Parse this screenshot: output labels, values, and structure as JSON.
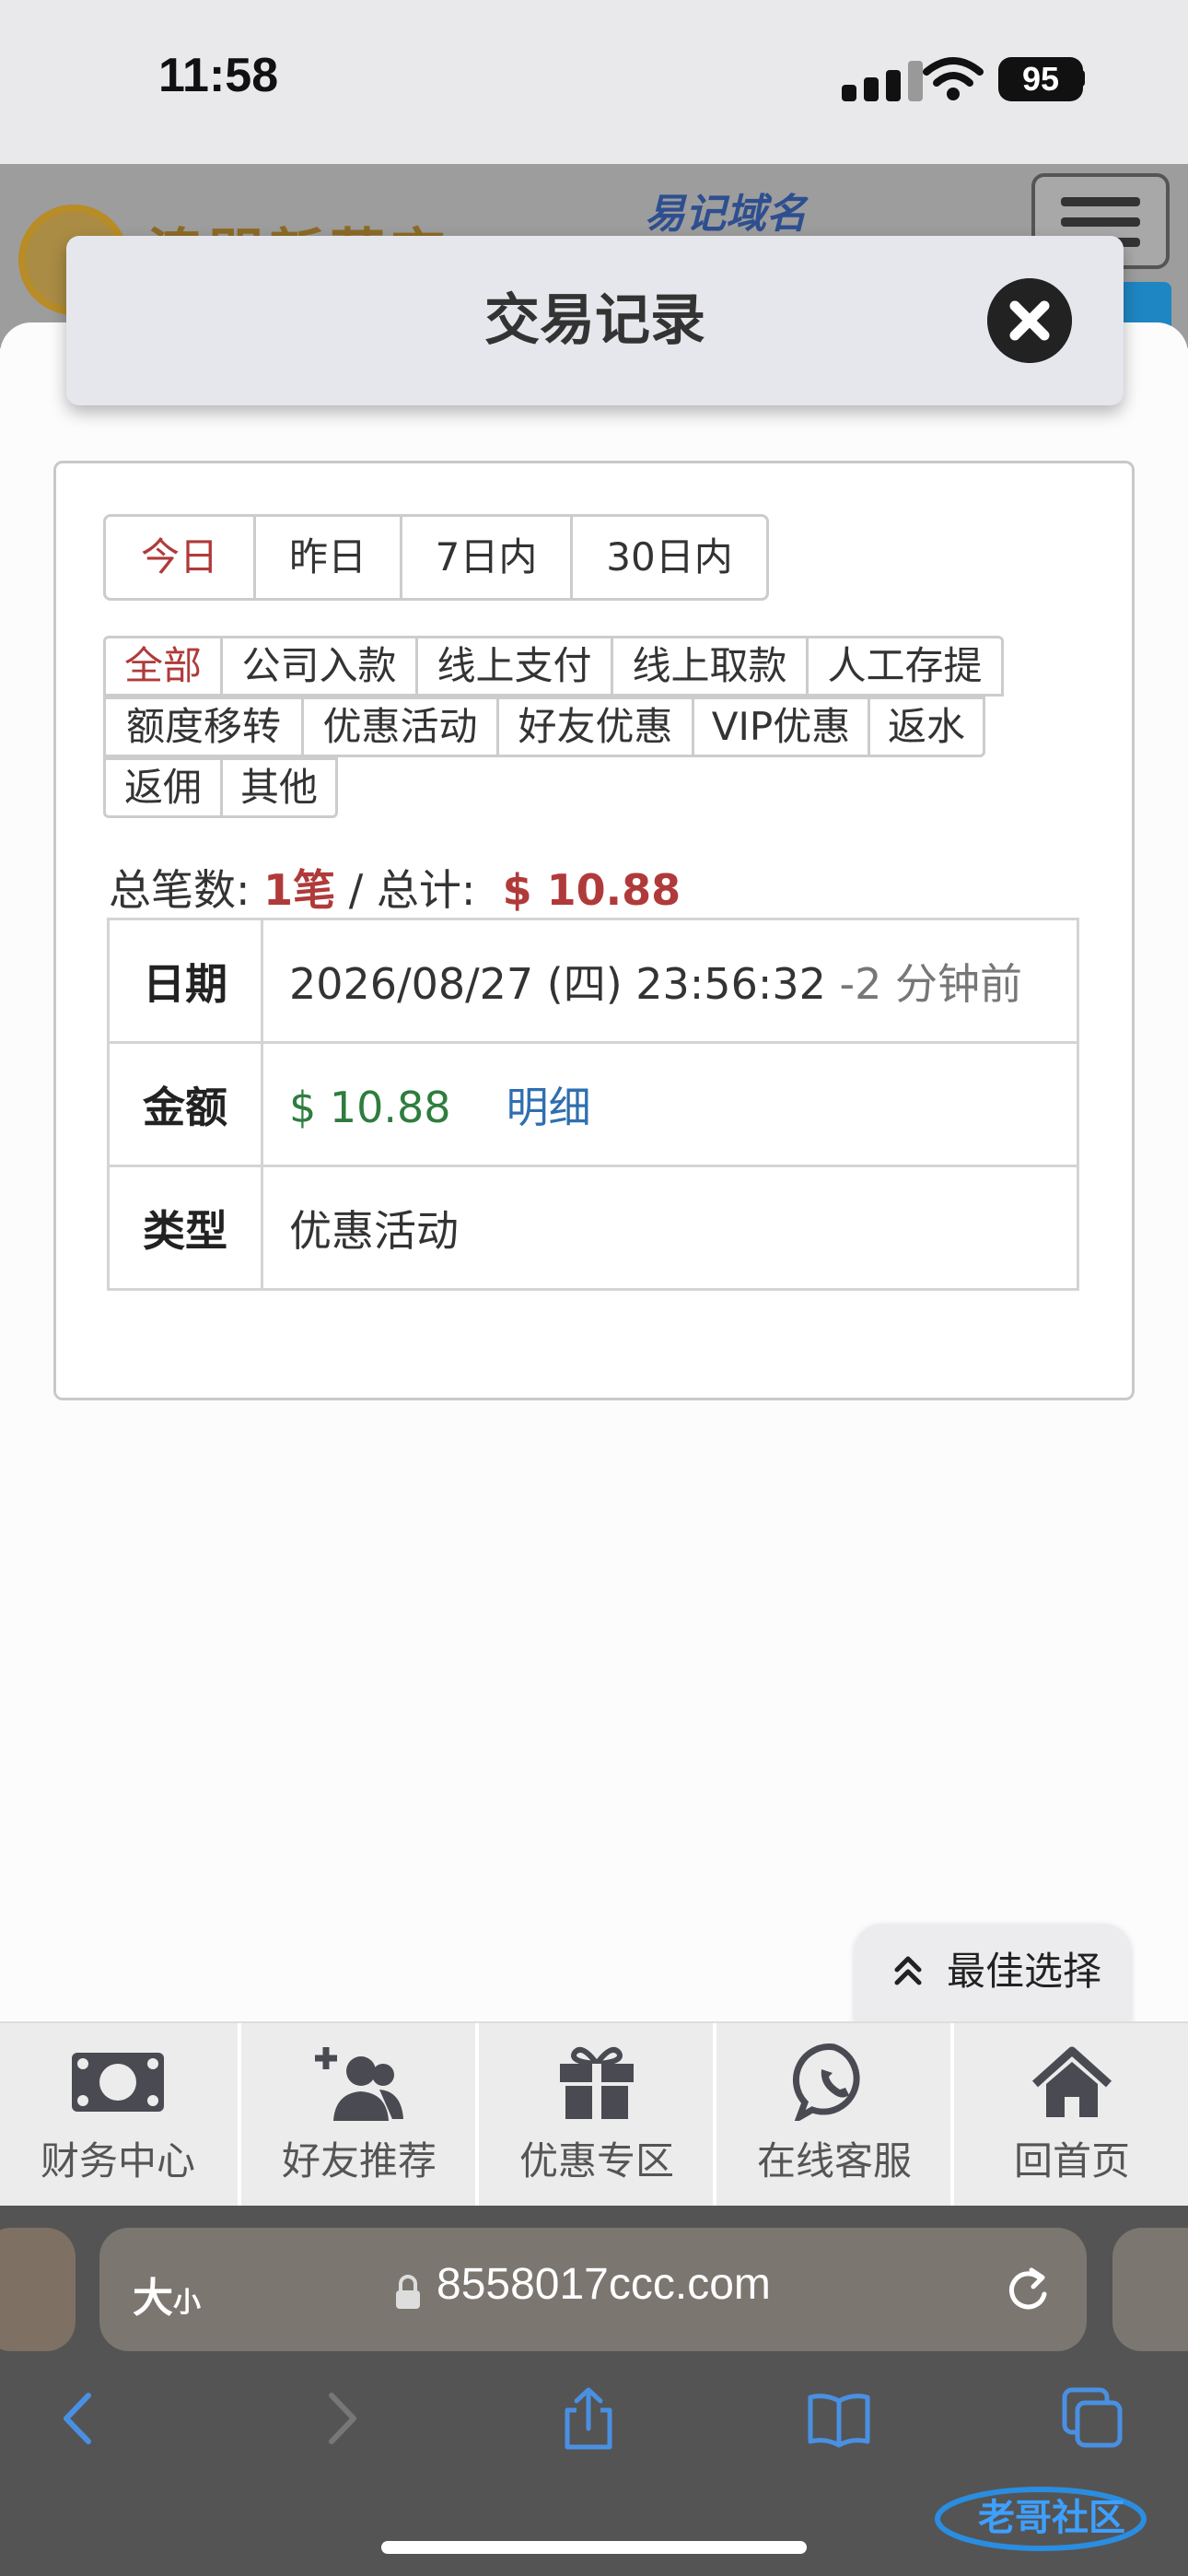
{
  "status_bar": {
    "time": "11:58",
    "battery": "95"
  },
  "site": {
    "brand": "澳門新葡京",
    "domain_link": "易记域名"
  },
  "modal": {
    "title": "交易记录"
  },
  "date_filters": [
    {
      "label": "今日",
      "active": true
    },
    {
      "label": "昨日",
      "active": false
    },
    {
      "label": "7日内",
      "active": false
    },
    {
      "label": "30日内",
      "active": false
    }
  ],
  "type_filters": [
    {
      "label": "全部",
      "active": true
    },
    {
      "label": "公司入款",
      "active": false
    },
    {
      "label": "线上支付",
      "active": false
    },
    {
      "label": "线上取款",
      "active": false
    },
    {
      "label": "人工存提",
      "active": false
    },
    {
      "label": "额度移转",
      "active": false
    },
    {
      "label": "优惠活动",
      "active": false
    },
    {
      "label": "好友优惠",
      "active": false
    },
    {
      "label": "VIP优惠",
      "active": false
    },
    {
      "label": "返水",
      "active": false
    },
    {
      "label": "返佣",
      "active": false
    },
    {
      "label": "其他",
      "active": false
    }
  ],
  "summary": {
    "count_label": "总笔数:",
    "count": "1笔",
    "separator": "/",
    "total_label": "总计:",
    "total": "$ 10.88"
  },
  "record": {
    "date_label": "日期",
    "date": "2026/08/27 (四) 23:56:32",
    "ago": "-2 分钟前",
    "amount_label": "金额",
    "amount": "$ 10.88",
    "detail_link": "明细",
    "type_label": "类型",
    "type": "优惠活动"
  },
  "best_choice": "最佳选择",
  "bottom_nav": [
    {
      "label": "财务中心",
      "icon": "money-icon"
    },
    {
      "label": "好友推荐",
      "icon": "add-friend-icon"
    },
    {
      "label": "优惠专区",
      "icon": "gift-icon"
    },
    {
      "label": "在线客服",
      "icon": "whatsapp-icon"
    },
    {
      "label": "回首页",
      "icon": "home-icon"
    }
  ],
  "browser": {
    "text_size_big": "大",
    "text_size_small": "小",
    "url": "8558017ccc.com"
  },
  "watermark": "老哥社区",
  "colors": {
    "active_red": "#b03a3a",
    "money_green": "#2e7d3e",
    "link_blue": "#2f6fb0"
  }
}
